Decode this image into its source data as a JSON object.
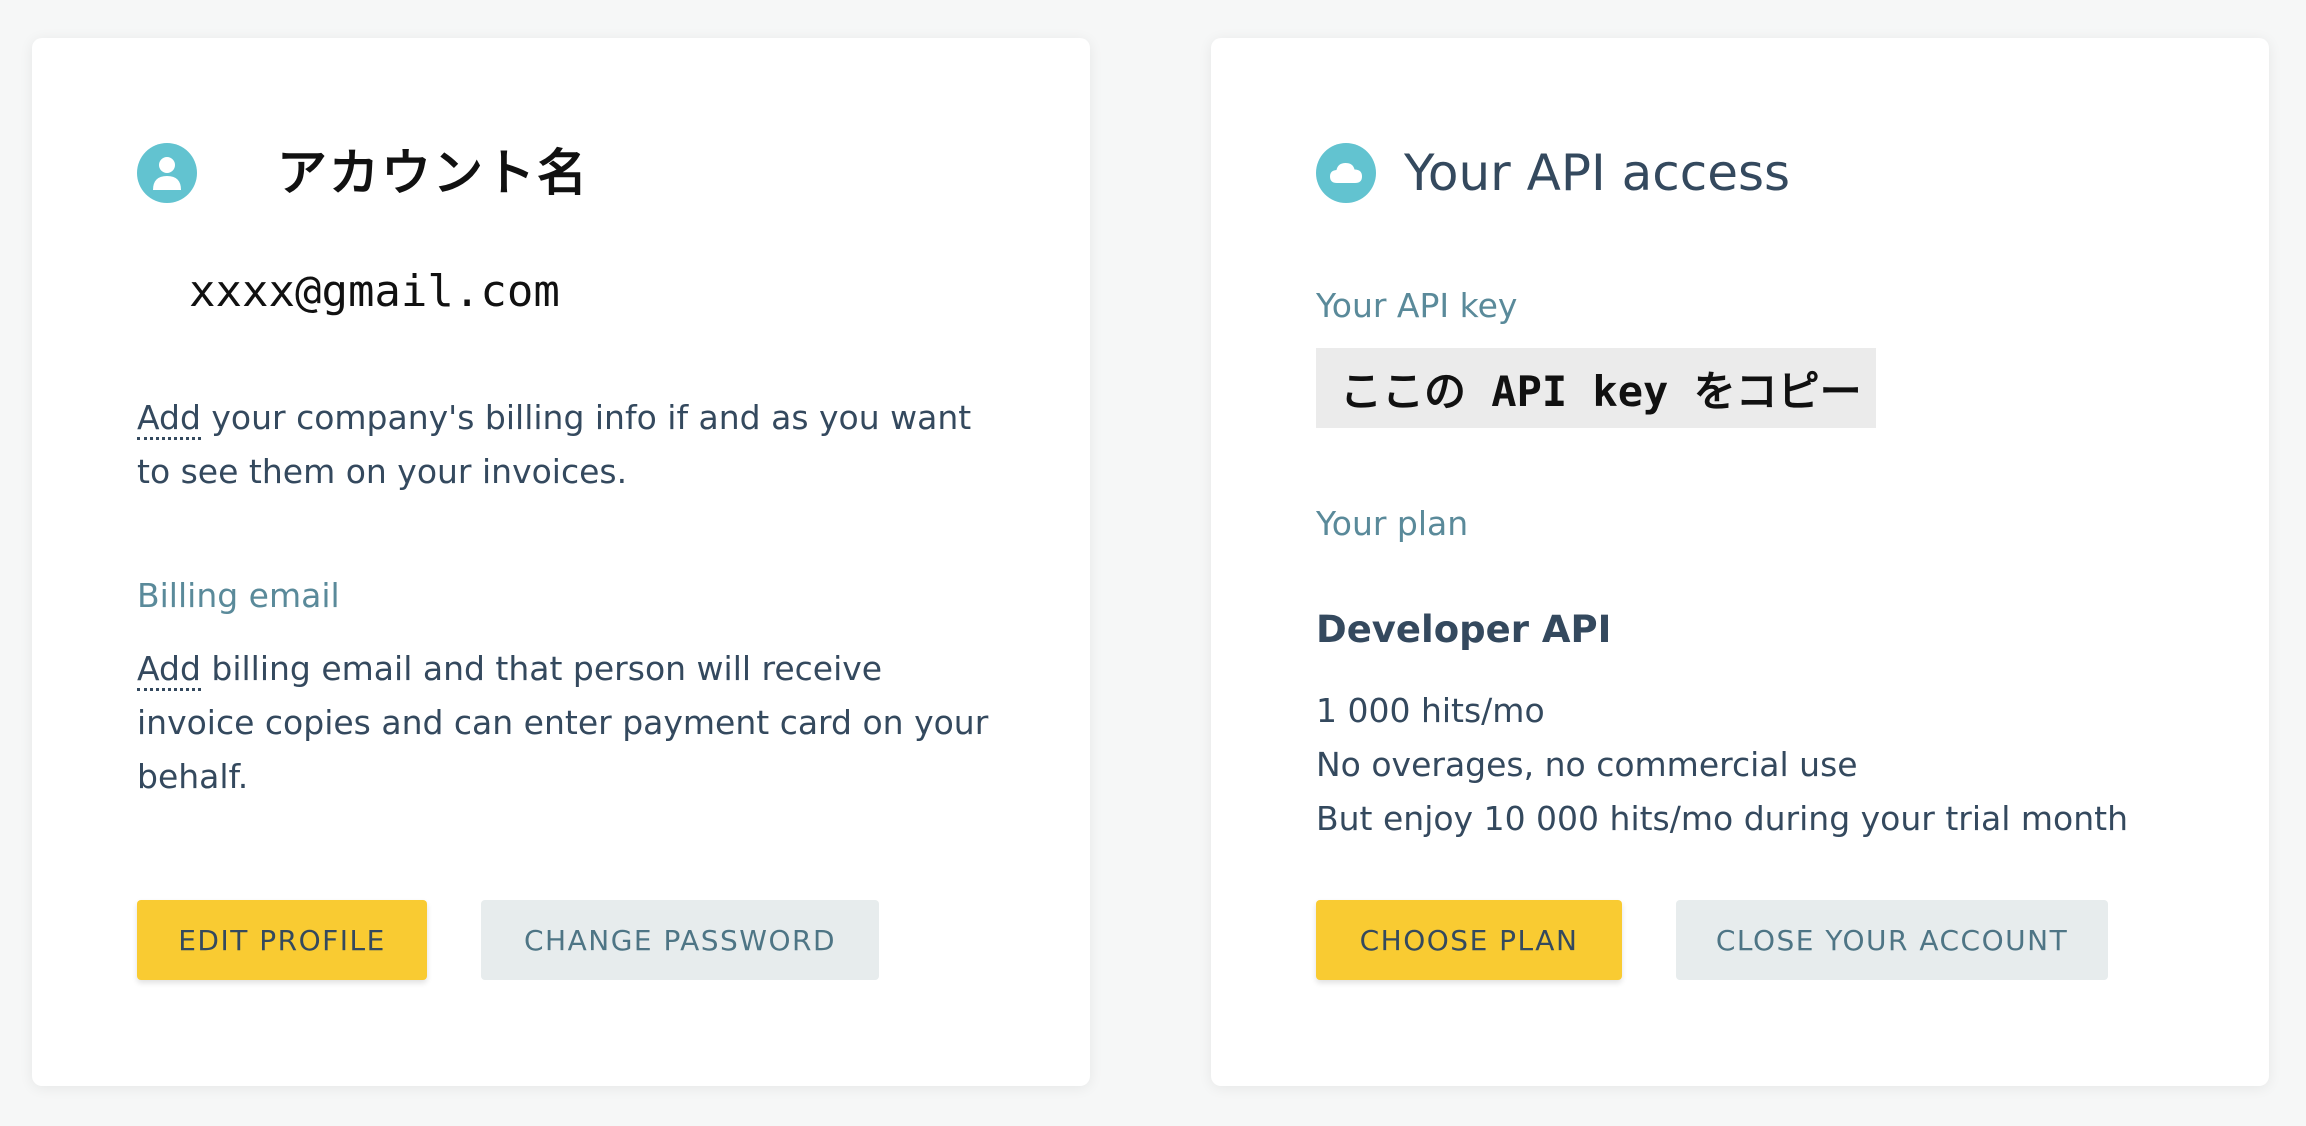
{
  "account_card": {
    "title": "アカウント名",
    "email": "xxxx@gmail.com",
    "billing_info": {
      "link": "Add",
      "text": " your company's billing info if and as you want to see them on your invoices."
    },
    "billing_email_label": "Billing email",
    "billing_email": {
      "link": "Add",
      "text": " billing email and that person will receive invoice copies and can enter payment card on your behalf."
    },
    "buttons": {
      "edit_profile": "EDIT PROFILE",
      "change_password": "CHANGE PASSWORD"
    }
  },
  "api_card": {
    "title": "Your API access",
    "api_key_label": "Your API key",
    "api_key_value": "ここの API key をコピー",
    "plan_label": "Your plan",
    "plan_name": "Developer API",
    "plan_details": [
      "1 000 hits/mo",
      "No overages, no commercial use",
      "But enjoy 10 000 hits/mo during your trial month"
    ],
    "buttons": {
      "choose_plan": "CHOOSE PLAN",
      "close_account": "CLOSE YOUR ACCOUNT"
    }
  },
  "colors": {
    "accent": "#62c3d0",
    "primary_button": "#f9cb32",
    "secondary_button": "#e7eced",
    "text": "#34495e",
    "label": "#5a8a9a"
  },
  "icons": {
    "account": "user-icon",
    "api": "cloud-icon"
  }
}
